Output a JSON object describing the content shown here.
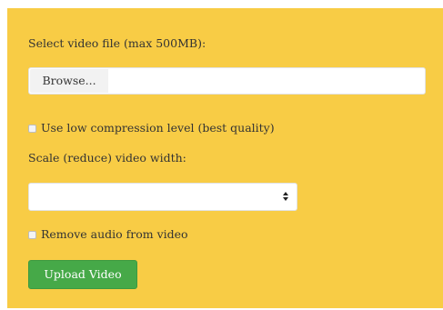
{
  "form": {
    "file_label": "Select video file (max 500MB):",
    "browse_label": "Browse...",
    "low_compression_label": "Use low compression level (best quality)",
    "low_compression_checked": false,
    "scale_label": "Scale (reduce) video width:",
    "scale_selected": "",
    "remove_audio_label": "Remove audio from video",
    "remove_audio_checked": false,
    "upload_label": "Upload Video"
  },
  "icons": {
    "select_arrows": "up-down-caret-icon"
  },
  "colors": {
    "panel_background": "#f8cc45",
    "upload_button": "#46a948",
    "text": "#333333"
  }
}
